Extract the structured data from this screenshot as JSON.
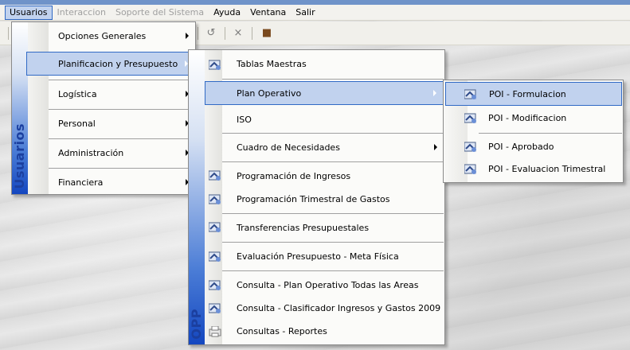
{
  "menubar": {
    "items": [
      "Usuarios",
      "Interaccion",
      "Soporte del Sistema",
      "Ayuda",
      "Ventana",
      "Salir"
    ]
  },
  "toolbar": {
    "icons": [
      "undo-icon",
      "close-icon",
      "exit-door-icon"
    ],
    "glyphs": [
      "↺",
      "×",
      "■"
    ]
  },
  "menu_usuarios": {
    "side_label": "Usuarios",
    "items": [
      "Opciones Generales",
      "Planificacion y Presupuesto",
      "Logística",
      "Personal",
      "Administración",
      "Financiera"
    ]
  },
  "menu_planificacion": {
    "side_label": "OPP",
    "items": [
      "Tablas Maestras",
      "Plan Operativo",
      "ISO",
      "Cuadro de Necesidades",
      "Programación de Ingresos",
      "Programación Trimestral de Gastos",
      "Transferencias Presupuestales",
      "Evaluación Presupuesto - Meta Física",
      "Consulta - Plan Operativo Todas las Areas",
      "Consulta - Clasificador Ingresos y Gastos 2009",
      "Consultas - Reportes"
    ]
  },
  "menu_poi": {
    "items": [
      "POI - Formulacion",
      "POI - Modificacion",
      "POI - Aprobado",
      "POI - Evaluacion Trimestral"
    ]
  },
  "colors": {
    "highlight": "#c1d2ee",
    "highlight_border": "#316ac5",
    "side_label": "#1b3f9f"
  }
}
